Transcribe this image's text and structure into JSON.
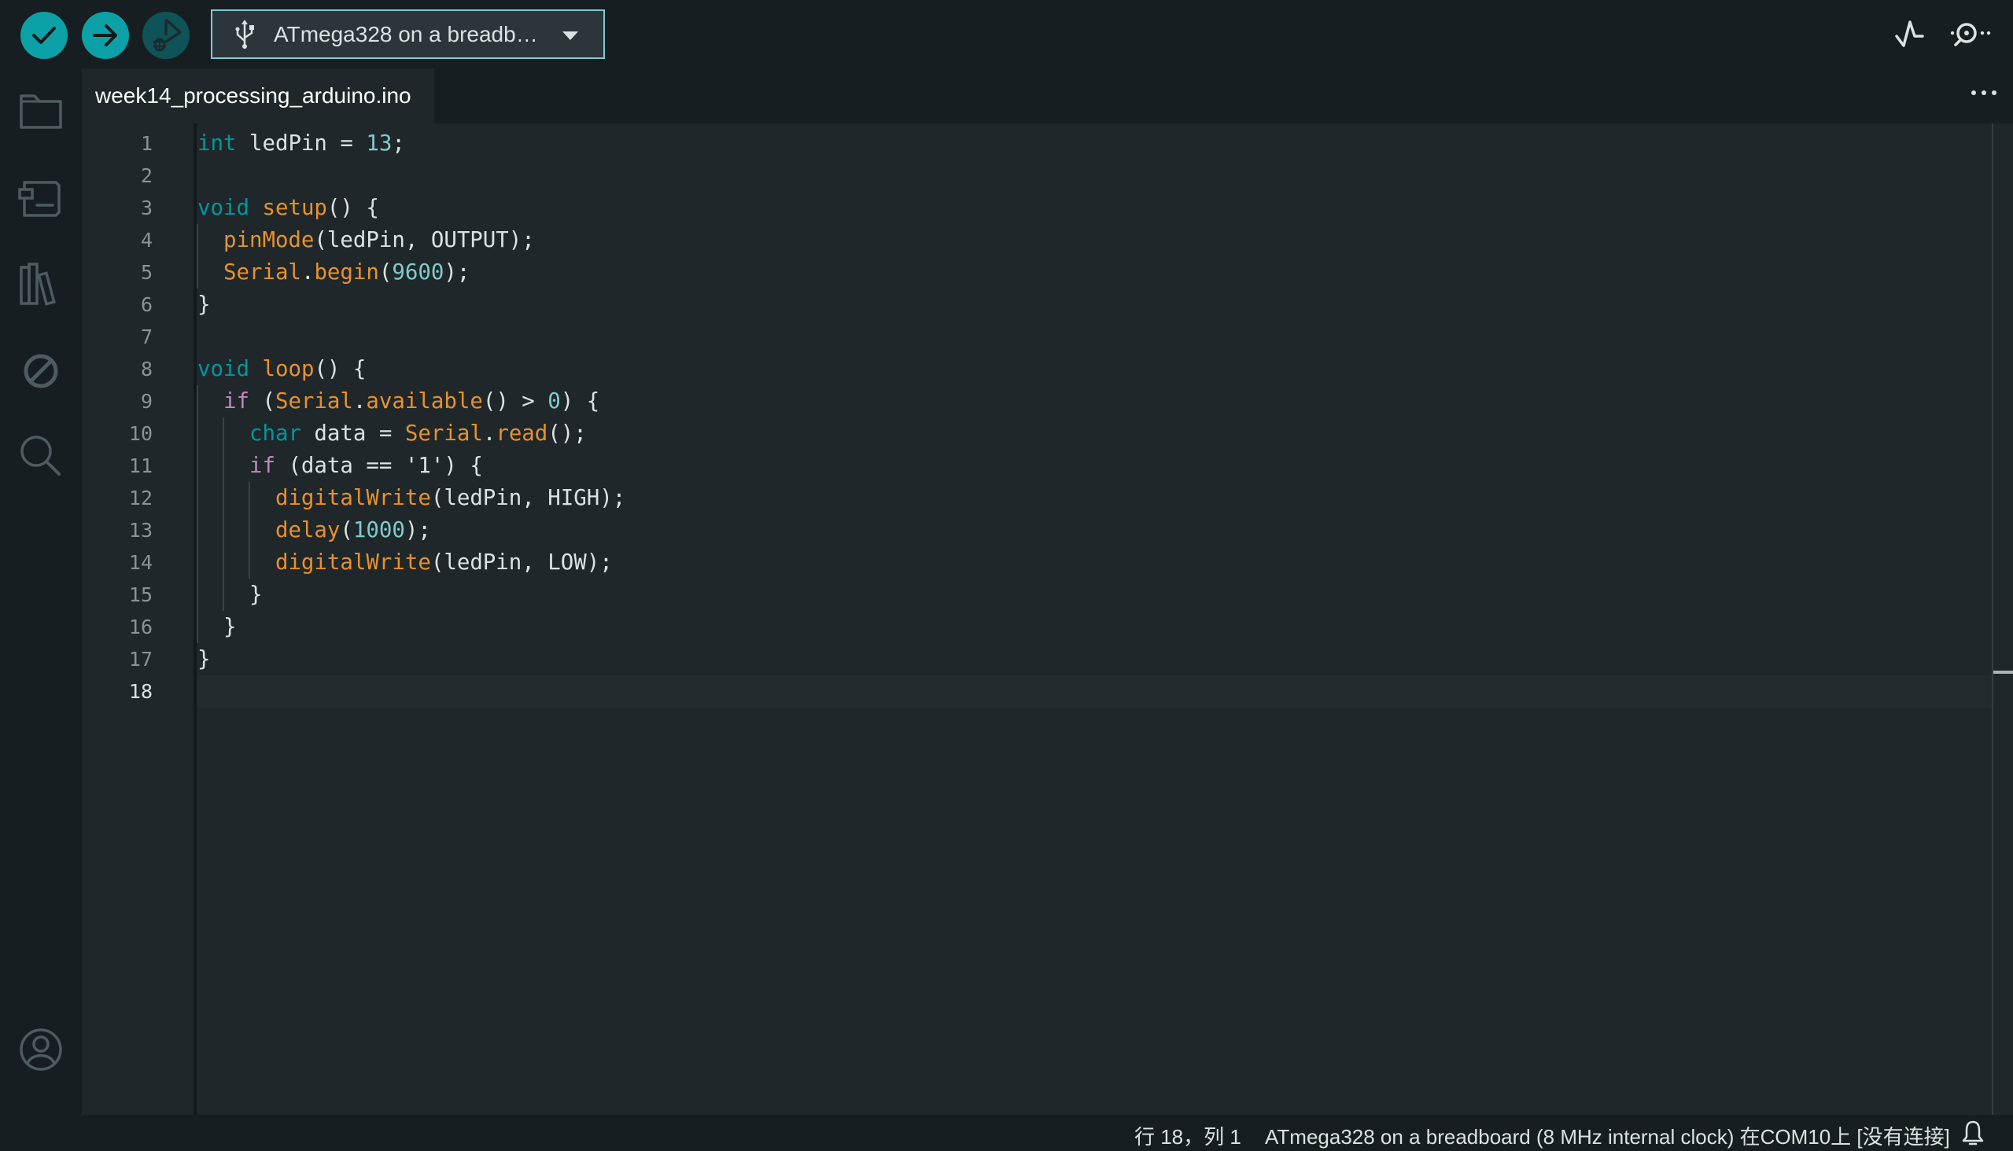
{
  "toolbar": {
    "verify_label": "Verify",
    "upload_label": "Upload",
    "debug_label": "Start Debugging",
    "board_selector": {
      "icon": "usb-icon",
      "label": "ATmega328 on a breadb…"
    },
    "serial_plotter_icon": "serial-plotter-icon",
    "serial_monitor_icon": "serial-monitor-icon"
  },
  "sidebar": {
    "items": [
      {
        "name": "sketchbook",
        "icon": "folder-icon"
      },
      {
        "name": "boards-manager",
        "icon": "board-icon"
      },
      {
        "name": "library-manager",
        "icon": "library-icon"
      },
      {
        "name": "debug",
        "icon": "debug-disabled-icon"
      },
      {
        "name": "search",
        "icon": "search-icon"
      }
    ],
    "account_icon": "account-icon"
  },
  "editor": {
    "tab_label": "week14_processing_arduino.ino",
    "more_icon": "more-horizontal-icon",
    "current_line": 18,
    "lines": [
      {
        "n": "1",
        "text": "int ledPin = 13;"
      },
      {
        "n": "2",
        "text": ""
      },
      {
        "n": "3",
        "text": "void setup() {"
      },
      {
        "n": "4",
        "text": "  pinMode(ledPin, OUTPUT);"
      },
      {
        "n": "5",
        "text": "  Serial.begin(9600);"
      },
      {
        "n": "6",
        "text": "}"
      },
      {
        "n": "7",
        "text": ""
      },
      {
        "n": "8",
        "text": "void loop() {"
      },
      {
        "n": "9",
        "text": "  if (Serial.available() > 0) {"
      },
      {
        "n": "10",
        "text": "    char data = Serial.read();"
      },
      {
        "n": "11",
        "text": "    if (data == '1') {"
      },
      {
        "n": "12",
        "text": "      digitalWrite(ledPin, HIGH);"
      },
      {
        "n": "13",
        "text": "      delay(1000);"
      },
      {
        "n": "14",
        "text": "      digitalWrite(ledPin, LOW);"
      },
      {
        "n": "15",
        "text": "    }"
      },
      {
        "n": "16",
        "text": "  }"
      },
      {
        "n": "17",
        "text": "}"
      },
      {
        "n": "18",
        "text": ""
      }
    ]
  },
  "statusbar": {
    "cursor_position": "行 18，列 1",
    "board_info": "ATmega328 on a breadboard (8 MHz internal clock) 在COM10上 [没有连接]",
    "notification_icon": "bell-icon"
  },
  "colors": {
    "accent": "#0ca1a6",
    "keyword_type": "#00979c",
    "keyword_control": "#c586c0",
    "function": "#e8912d",
    "number": "#7fcbcd",
    "background": "#171e21",
    "editor_background": "#1f272a"
  }
}
